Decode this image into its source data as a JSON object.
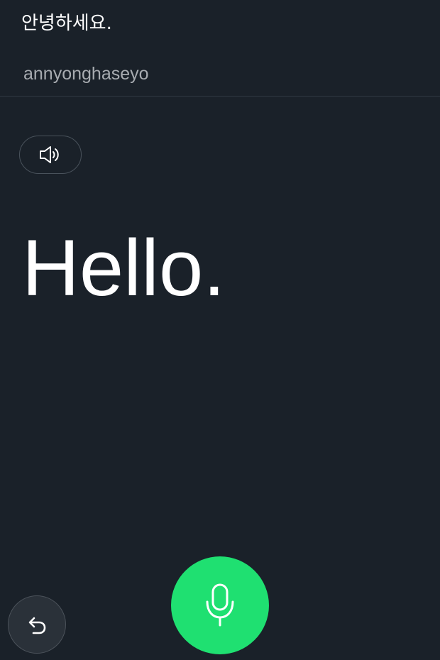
{
  "source": {
    "text": "안녕하세요.",
    "romanization": "annyonghaseyo"
  },
  "translation": {
    "text": "Hello."
  },
  "controls": {
    "speaker_icon": "speaker-icon",
    "undo_icon": "undo-icon",
    "mic_icon": "microphone-icon"
  },
  "colors": {
    "background": "#1a2129",
    "mic_button": "#1fe071",
    "romanization": "#a7abb0"
  }
}
